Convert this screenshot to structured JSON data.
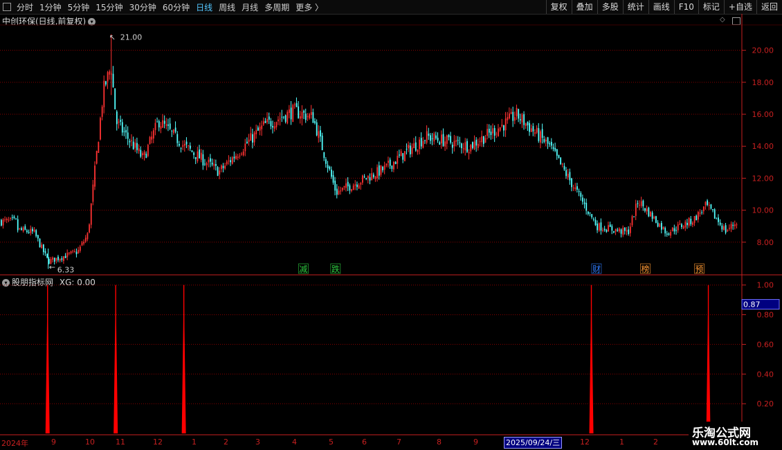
{
  "toolbar": {
    "periods": [
      "分时",
      "1分钟",
      "5分钟",
      "15分钟",
      "30分钟",
      "60分钟",
      "日线",
      "周线",
      "月线",
      "多周期",
      "更多 〉"
    ],
    "active_period": "日线",
    "buttons": [
      "复权",
      "叠加",
      "多股",
      "统计",
      "画线",
      "F10",
      "标记",
      "+自选",
      "返回"
    ]
  },
  "main_panel": {
    "title": "中创环保(日线,前复权)",
    "y_ticks": [
      "20.00",
      "18.00",
      "16.00",
      "14.00",
      "12.00",
      "10.00",
      "8.00"
    ],
    "high_label": "21.00",
    "low_label": "6.33",
    "markers": [
      {
        "text": "减",
        "color": "#2ecc40",
        "date": "2025-03-13"
      },
      {
        "text": "跌",
        "color": "#2ecc40",
        "date": "2025-04-07"
      },
      {
        "text": "财",
        "color": "#2f7dff",
        "date": "2025-10-27"
      },
      {
        "text": "榜",
        "color": "#ff9933",
        "date": "2025-12-04"
      },
      {
        "text": "预",
        "color": "#ff9933",
        "date": "2026-01-15"
      }
    ]
  },
  "sub_panel": {
    "title": "股朋指标网",
    "xg_label": "XG: 0.00",
    "y_ticks": [
      "1.00",
      "0.80",
      "0.60",
      "0.40",
      "0.20"
    ],
    "current_value": "0.87"
  },
  "x_axis": {
    "labels": [
      "2024年",
      "9",
      "10",
      "11",
      "12",
      "1",
      "2",
      "3",
      "4",
      "5",
      "6",
      "7",
      "8",
      "9",
      "2025/09/24/三",
      "12",
      "1",
      "2"
    ],
    "highlight_date": "2025/09/24/三"
  },
  "watermark": {
    "line1": "乐淘公式网",
    "line2": "www.60lt.com"
  },
  "colors": {
    "up": "#ff3232",
    "down": "#54ffff",
    "axis": "#c82020",
    "grid": "#8b0000",
    "signal": "#ff0000"
  },
  "chart_data": [
    {
      "type": "candlestick",
      "title": "中创环保(日线,前复权)",
      "x_range": [
        "2024-08",
        "2026-02"
      ],
      "ylim": [
        6.0,
        21.5
      ],
      "y_ticks": [
        8,
        10,
        12,
        14,
        16,
        18,
        20
      ],
      "highest": {
        "value": 21.0,
        "date": "2024-10-14"
      },
      "lowest": {
        "value": 6.33,
        "date": "2024-08-26"
      },
      "close_trend": [
        {
          "x": "2024-08-01",
          "y": 8.8
        },
        {
          "x": "2024-08-15",
          "y": 8.6
        },
        {
          "x": "2024-08-26",
          "y": 6.8
        },
        {
          "x": "2024-09-18",
          "y": 7.4
        },
        {
          "x": "2024-09-26",
          "y": 8.5
        },
        {
          "x": "2024-09-30",
          "y": 11.5
        },
        {
          "x": "2024-10-08",
          "y": 17.5
        },
        {
          "x": "2024-10-14",
          "y": 19.0
        },
        {
          "x": "2024-10-18",
          "y": 15.5
        },
        {
          "x": "2024-11-08",
          "y": 13.2
        },
        {
          "x": "2024-11-20",
          "y": 15.6
        },
        {
          "x": "2024-12-10",
          "y": 14.0
        },
        {
          "x": "2025-01-06",
          "y": 12.4
        },
        {
          "x": "2025-02-10",
          "y": 15.3
        },
        {
          "x": "2025-03-05",
          "y": 16.2
        },
        {
          "x": "2025-03-20",
          "y": 15.8
        },
        {
          "x": "2025-04-07",
          "y": 11.1
        },
        {
          "x": "2025-05-15",
          "y": 12.6
        },
        {
          "x": "2025-06-16",
          "y": 14.6
        },
        {
          "x": "2025-07-20",
          "y": 14.0
        },
        {
          "x": "2025-08-18",
          "y": 15.5
        },
        {
          "x": "2025-08-25",
          "y": 16.0
        },
        {
          "x": "2025-09-20",
          "y": 14.0
        },
        {
          "x": "2025-10-10",
          "y": 11.3
        },
        {
          "x": "2025-10-27",
          "y": 9.0
        },
        {
          "x": "2025-11-20",
          "y": 8.6
        },
        {
          "x": "2025-11-28",
          "y": 10.6
        },
        {
          "x": "2025-12-20",
          "y": 8.6
        },
        {
          "x": "2026-01-10",
          "y": 9.4
        },
        {
          "x": "2026-01-20",
          "y": 10.3
        },
        {
          "x": "2026-02-04",
          "y": 8.7
        },
        {
          "x": "2026-02-13",
          "y": 9.3
        }
      ]
    },
    {
      "type": "bar",
      "title": "股朋指标网",
      "series": [
        {
          "name": "XG",
          "x": [
            "2024-08-26",
            "2024-10-18",
            "2024-12-10",
            "2025-10-23",
            "2026-01-22"
          ],
          "values": [
            1,
            1,
            1,
            1,
            1
          ]
        }
      ],
      "ylim": [
        0,
        1.05
      ],
      "y_ticks": [
        0.2,
        0.4,
        0.6,
        0.8,
        1.0
      ],
      "current": 0.87
    }
  ]
}
